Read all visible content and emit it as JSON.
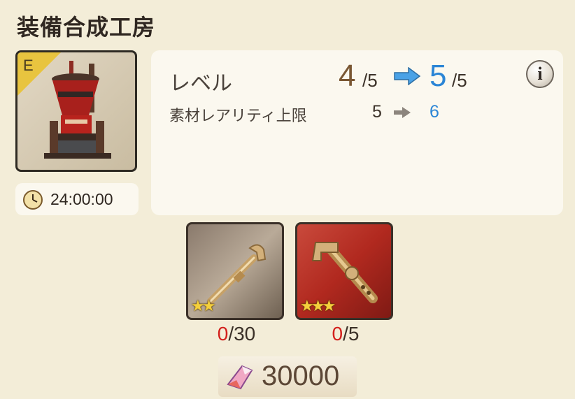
{
  "header": {
    "title": "装備合成工房"
  },
  "facility": {
    "rank": "E",
    "icon": "synthesis-machine-icon",
    "timer": "24:00:00",
    "timer_icon": "clock-icon"
  },
  "upgrade": {
    "level_label": "レベル",
    "level_current": "4",
    "level_current_max": "/5",
    "level_next": "5",
    "level_next_max": "/5",
    "rarity_label": "素材レアリティ上限",
    "rarity_current": "5",
    "rarity_next": "6",
    "info_label": "i",
    "colors": {
      "current": "#7a5733",
      "next": "#2b85d6",
      "arrow": "#4aa2e6"
    }
  },
  "materials": [
    {
      "icon": "brass-pipe-icon",
      "stars": "★★",
      "have": "0",
      "need": "/30",
      "frame_color": "#8a7a6c"
    },
    {
      "icon": "ornate-brass-pipe-icon",
      "stars": "★★★",
      "have": "0",
      "need": "/5",
      "frame_color": "#b1291f"
    }
  ],
  "cost": {
    "icon": "crystal-icon",
    "value": "30000"
  }
}
